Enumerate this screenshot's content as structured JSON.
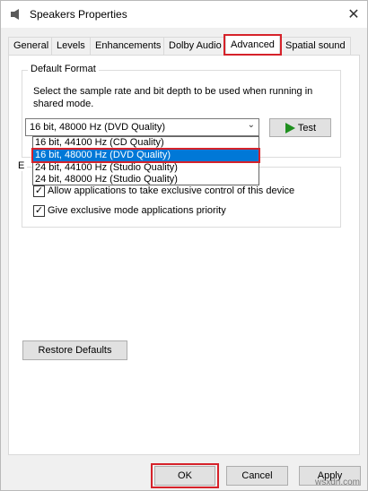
{
  "window": {
    "title": "Speakers Properties",
    "close_label": "✕"
  },
  "tabs": [
    {
      "label": "General"
    },
    {
      "label": "Levels"
    },
    {
      "label": "Enhancements"
    },
    {
      "label": "Dolby Audio"
    },
    {
      "label": "Advanced",
      "active": true
    },
    {
      "label": "Spatial sound"
    }
  ],
  "default_format": {
    "title": "Default Format",
    "description": "Select the sample rate and bit depth to be used when running in shared mode.",
    "selected_value": "16 bit, 48000 Hz (DVD Quality)",
    "options": [
      "16 bit, 44100 Hz (CD Quality)",
      "16 bit, 48000 Hz (DVD Quality)",
      "24 bit, 44100 Hz (Studio Quality)",
      "24 bit, 48000 Hz (Studio Quality)"
    ],
    "highlighted_option": "16 bit, 48000 Hz (DVD Quality)",
    "test_label": "Test"
  },
  "exclusive_mode": {
    "title_visible_fragment": "E",
    "allow_exclusive_label": "Allow applications to take exclusive control of this device",
    "allow_exclusive_checked": true,
    "priority_label": "Give exclusive mode applications priority",
    "priority_checked": true
  },
  "restore_defaults_label": "Restore Defaults",
  "footer": {
    "ok_label": "OK",
    "cancel_label": "Cancel",
    "apply_label": "Apply"
  },
  "watermark": "wsxdn.com",
  "colors": {
    "highlight_red": "#d6222a",
    "selection_blue": "#0078d7",
    "test_arrow_green": "#1f8f1f"
  }
}
